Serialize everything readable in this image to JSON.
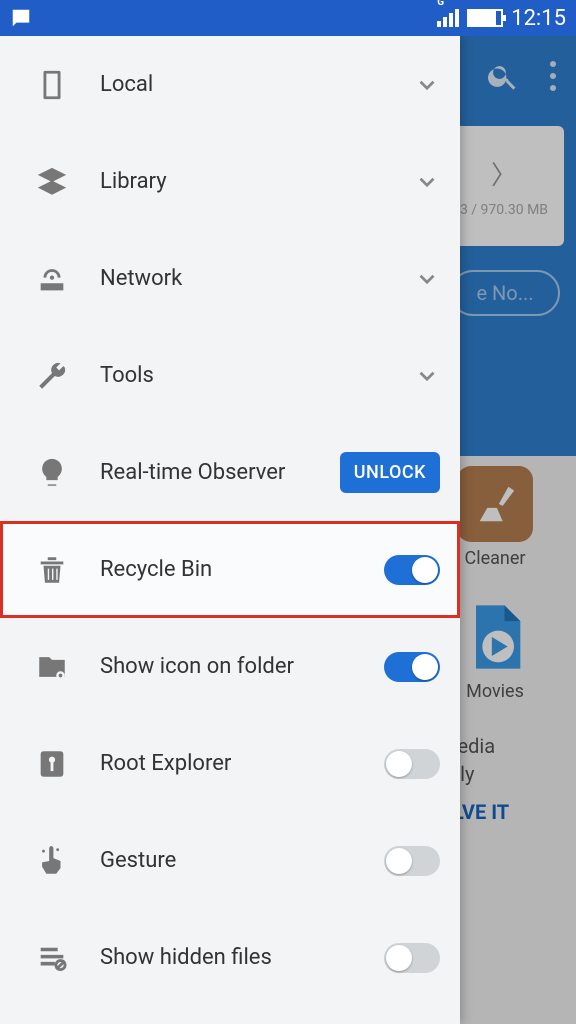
{
  "statusbar": {
    "time": "12:15",
    "signal_label": "G"
  },
  "background": {
    "storage": "3 / 970.30 MB",
    "analyze_button": "e No...",
    "tiles": {
      "cleaner": "Cleaner",
      "movies": "Movies"
    },
    "promo_line1": "media",
    "promo_line2": "vely",
    "promo_action": "DLVE IT"
  },
  "drawer": {
    "local": "Local",
    "library": "Library",
    "network": "Network",
    "tools": "Tools",
    "observer": "Real-time Observer",
    "unlock": "UNLOCK",
    "recycle": "Recycle Bin",
    "show_icon": "Show icon on folder",
    "root": "Root Explorer",
    "gesture": "Gesture",
    "hidden": "Show hidden files"
  },
  "toggles": {
    "recycle": true,
    "show_icon": true,
    "root": false,
    "gesture": false,
    "hidden": false
  }
}
